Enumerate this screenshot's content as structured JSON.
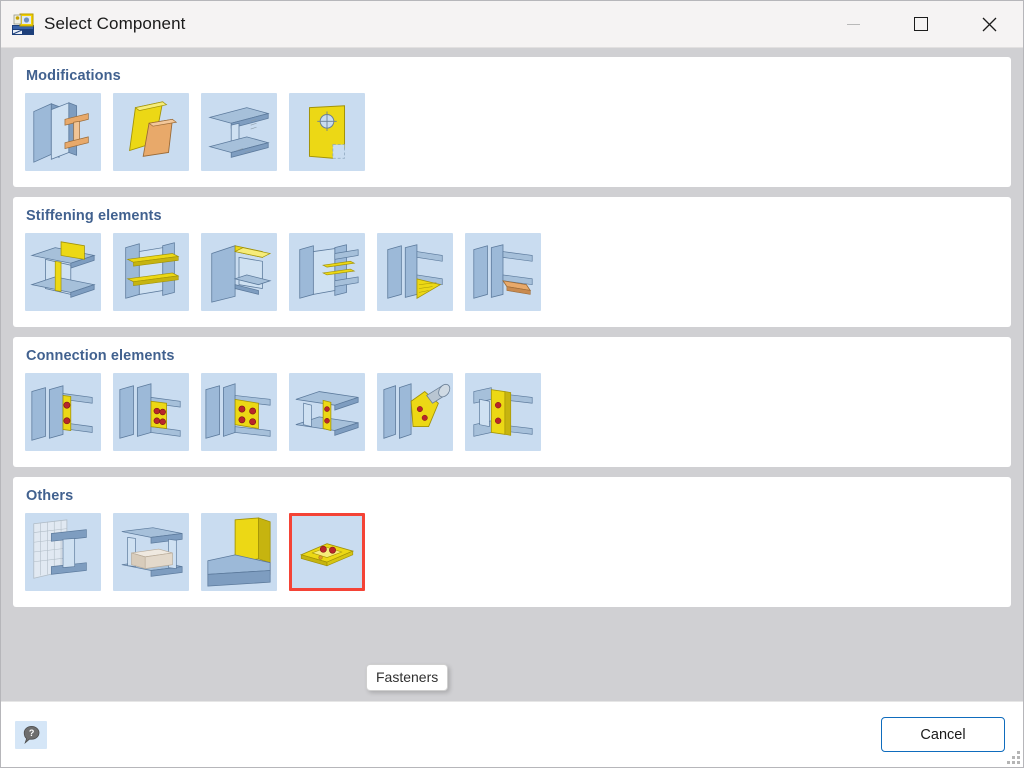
{
  "window": {
    "title": "Select Component",
    "icon": "app-icon",
    "controls": {
      "minimize": "minimize-icon",
      "maximize": "maximize-icon",
      "close": "close-icon"
    }
  },
  "groups": [
    {
      "title": "Modifications",
      "items": [
        {
          "name": "beam-cut-modification",
          "art": "m1"
        },
        {
          "name": "plate-bend-modification",
          "art": "m2"
        },
        {
          "name": "beam-notch-modification",
          "art": "m3"
        },
        {
          "name": "plate-hole-modification",
          "art": "m4"
        }
      ]
    },
    {
      "title": "Stiffening elements",
      "items": [
        {
          "name": "web-stiffener",
          "art": "s1"
        },
        {
          "name": "double-flange-stiffener",
          "art": "s2"
        },
        {
          "name": "top-plate-stiffener",
          "art": "s3"
        },
        {
          "name": "multi-rib-stiffener",
          "art": "s4"
        },
        {
          "name": "haunch-stiffener",
          "art": "s5"
        },
        {
          "name": "angle-stiffener",
          "art": "s6"
        }
      ]
    },
    {
      "title": "Connection elements",
      "items": [
        {
          "name": "end-plate-connection",
          "art": "c1"
        },
        {
          "name": "fin-plate-connection",
          "art": "c2"
        },
        {
          "name": "bolted-plate-connection",
          "art": "c3"
        },
        {
          "name": "web-cleat-connection",
          "art": "c4"
        },
        {
          "name": "tube-gusset-connection",
          "art": "c5"
        },
        {
          "name": "splice-plate-connection",
          "art": "c6"
        }
      ]
    },
    {
      "title": "Others",
      "items": [
        {
          "name": "mesh-wall-element",
          "art": "o1"
        },
        {
          "name": "concrete-block-element",
          "art": "o2"
        },
        {
          "name": "weld-seam-element",
          "art": "o3"
        },
        {
          "name": "fasteners-element",
          "art": "o4",
          "selected": true
        }
      ]
    }
  ],
  "tooltip": {
    "text": "Fasteners"
  },
  "footer": {
    "help_icon": "help-icon",
    "cancel_label": "Cancel",
    "resize_grip": "resize-grip"
  },
  "colors": {
    "dialog_background": "#d0d0d3",
    "panel_background": "#ffffff",
    "group_title": "#41618f",
    "thumbnail_background": "#c9dcf0",
    "selection_outline": "#f44336",
    "accent_button_border": "#0f6cbd",
    "steel_blue": "#8fadd0",
    "highlight_yellow": "#ecd815",
    "bolt_red": "#b8262a",
    "copper": "#e8a96a"
  }
}
